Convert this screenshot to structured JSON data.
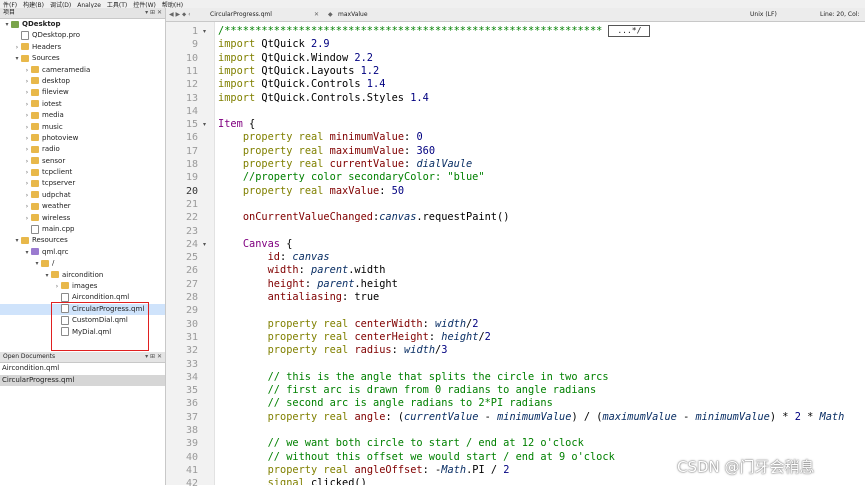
{
  "menubar": [
    "件(F)",
    "构建(B)",
    "调试(D)",
    "Analyze",
    "工具(T)",
    "控件(W)",
    "帮助(H)"
  ],
  "projects_panel": {
    "title": "项目",
    "controls": "▾  ⊞  ✕",
    "tree": [
      {
        "label": "QDesktop",
        "depth": 0,
        "arrow": "▾",
        "icon": "proj",
        "bold": true
      },
      {
        "label": "QDesktop.pro",
        "depth": 1,
        "arrow": "",
        "icon": "file"
      },
      {
        "label": "Headers",
        "depth": 1,
        "arrow": "›",
        "icon": "folder"
      },
      {
        "label": "Sources",
        "depth": 1,
        "arrow": "▾",
        "icon": "folder"
      },
      {
        "label": "cameramedia",
        "depth": 2,
        "arrow": "›",
        "icon": "folder"
      },
      {
        "label": "desktop",
        "depth": 2,
        "arrow": "›",
        "icon": "folder"
      },
      {
        "label": "fileview",
        "depth": 2,
        "arrow": "›",
        "icon": "folder"
      },
      {
        "label": "iotest",
        "depth": 2,
        "arrow": "›",
        "icon": "folder"
      },
      {
        "label": "media",
        "depth": 2,
        "arrow": "›",
        "icon": "folder"
      },
      {
        "label": "music",
        "depth": 2,
        "arrow": "›",
        "icon": "folder"
      },
      {
        "label": "photoview",
        "depth": 2,
        "arrow": "›",
        "icon": "folder"
      },
      {
        "label": "radio",
        "depth": 2,
        "arrow": "›",
        "icon": "folder"
      },
      {
        "label": "sensor",
        "depth": 2,
        "arrow": "›",
        "icon": "folder"
      },
      {
        "label": "tcpclient",
        "depth": 2,
        "arrow": "›",
        "icon": "folder"
      },
      {
        "label": "tcpserver",
        "depth": 2,
        "arrow": "›",
        "icon": "folder"
      },
      {
        "label": "udpchat",
        "depth": 2,
        "arrow": "›",
        "icon": "folder"
      },
      {
        "label": "weather",
        "depth": 2,
        "arrow": "›",
        "icon": "folder"
      },
      {
        "label": "wireless",
        "depth": 2,
        "arrow": "›",
        "icon": "folder"
      },
      {
        "label": "main.cpp",
        "depth": 2,
        "arrow": "",
        "icon": "file"
      },
      {
        "label": "Resources",
        "depth": 1,
        "arrow": "▾",
        "icon": "folder"
      },
      {
        "label": "qml.qrc",
        "depth": 2,
        "arrow": "▾",
        "icon": "res"
      },
      {
        "label": "/",
        "depth": 3,
        "arrow": "▾",
        "icon": "folder"
      },
      {
        "label": "aircondition",
        "depth": 4,
        "arrow": "▾",
        "icon": "folder"
      },
      {
        "label": "images",
        "depth": 5,
        "arrow": "›",
        "icon": "folder"
      },
      {
        "label": "Aircondition.qml",
        "depth": 5,
        "arrow": "",
        "icon": "file"
      },
      {
        "label": "CircularProgress.qml",
        "depth": 5,
        "arrow": "",
        "icon": "file",
        "selected": true
      },
      {
        "label": "CustomDial.qml",
        "depth": 5,
        "arrow": "",
        "icon": "file"
      },
      {
        "label": "MyDial.qml",
        "depth": 5,
        "arrow": "",
        "icon": "file"
      }
    ]
  },
  "open_documents": {
    "title": "Open Documents",
    "controls": "▾  ⊞  ✕",
    "items": [
      {
        "label": "Aircondition.qml",
        "selected": false
      },
      {
        "label": "CircularProgress.qml",
        "selected": true
      }
    ]
  },
  "editor": {
    "nav": "◀  ▶  ⬥  ‹",
    "file_name": "CircularProgress.qml",
    "close_glyph": "✕",
    "symbol_prefix": "◆",
    "symbol": "maxValue",
    "encoding": "Unix (LF)",
    "position": "Line: 20, Col:",
    "fold_badge": "...*/",
    "current_line": 20,
    "lines": [
      {
        "n": "1",
        "fold": "▾",
        "segs": [
          [
            "cm",
            "/*************************************************************"
          ]
        ],
        "badge": true
      },
      {
        "n": "9",
        "segs": [
          [
            "kw",
            "import"
          ],
          [
            "pl",
            " QtQuick "
          ],
          [
            "num",
            "2.9"
          ]
        ]
      },
      {
        "n": "10",
        "segs": [
          [
            "kw",
            "import"
          ],
          [
            "pl",
            " QtQuick.Window "
          ],
          [
            "num",
            "2.2"
          ]
        ]
      },
      {
        "n": "11",
        "segs": [
          [
            "kw",
            "import"
          ],
          [
            "pl",
            " QtQuick.Layouts "
          ],
          [
            "num",
            "1.2"
          ]
        ]
      },
      {
        "n": "12",
        "segs": [
          [
            "kw",
            "import"
          ],
          [
            "pl",
            " QtQuick.Controls "
          ],
          [
            "num",
            "1.4"
          ]
        ]
      },
      {
        "n": "13",
        "segs": [
          [
            "kw",
            "import"
          ],
          [
            "pl",
            " QtQuick.Controls.Styles "
          ],
          [
            "num",
            "1.4"
          ]
        ]
      },
      {
        "n": "14",
        "segs": []
      },
      {
        "n": "15",
        "fold": "▾",
        "segs": [
          [
            "ty",
            "Item"
          ],
          [
            "pl",
            " {"
          ]
        ]
      },
      {
        "n": "16",
        "segs": [
          [
            "pl",
            "    "
          ],
          [
            "kw",
            "property"
          ],
          [
            "pl",
            " "
          ],
          [
            "kw",
            "real"
          ],
          [
            "pl",
            " "
          ],
          [
            "prop",
            "minimumValue"
          ],
          [
            "pl",
            ": "
          ],
          [
            "num",
            "0"
          ]
        ]
      },
      {
        "n": "17",
        "segs": [
          [
            "pl",
            "    "
          ],
          [
            "kw",
            "property"
          ],
          [
            "pl",
            " "
          ],
          [
            "kw",
            "real"
          ],
          [
            "pl",
            " "
          ],
          [
            "prop",
            "maximumValue"
          ],
          [
            "pl",
            ": "
          ],
          [
            "num",
            "360"
          ]
        ]
      },
      {
        "n": "18",
        "segs": [
          [
            "pl",
            "    "
          ],
          [
            "kw",
            "property"
          ],
          [
            "pl",
            " "
          ],
          [
            "kw",
            "real"
          ],
          [
            "pl",
            " "
          ],
          [
            "prop",
            "currentValue"
          ],
          [
            "pl",
            ": "
          ],
          [
            "it",
            "dialVaule"
          ]
        ]
      },
      {
        "n": "19",
        "segs": [
          [
            "pl",
            "    "
          ],
          [
            "cm",
            "//property color secondaryColor: \"blue\""
          ]
        ]
      },
      {
        "n": "20",
        "segs": [
          [
            "pl",
            "    "
          ],
          [
            "kw",
            "property"
          ],
          [
            "pl",
            " "
          ],
          [
            "kw",
            "real"
          ],
          [
            "pl",
            " "
          ],
          [
            "prop",
            "maxValue"
          ],
          [
            "pl",
            ": "
          ],
          [
            "num",
            "50"
          ]
        ]
      },
      {
        "n": "21",
        "segs": []
      },
      {
        "n": "22",
        "segs": [
          [
            "pl",
            "    "
          ],
          [
            "prop",
            "onCurrentValueChanged"
          ],
          [
            "pl",
            ":"
          ],
          [
            "it",
            "canvas"
          ],
          [
            "pl",
            ".requestPaint()"
          ]
        ]
      },
      {
        "n": "23",
        "segs": []
      },
      {
        "n": "24",
        "fold": "▾",
        "segs": [
          [
            "pl",
            "    "
          ],
          [
            "ty",
            "Canvas"
          ],
          [
            "pl",
            " {"
          ]
        ]
      },
      {
        "n": "25",
        "segs": [
          [
            "pl",
            "        "
          ],
          [
            "prop",
            "id"
          ],
          [
            "pl",
            ": "
          ],
          [
            "it",
            "canvas"
          ]
        ]
      },
      {
        "n": "26",
        "segs": [
          [
            "pl",
            "        "
          ],
          [
            "prop",
            "width"
          ],
          [
            "pl",
            ": "
          ],
          [
            "it",
            "parent"
          ],
          [
            "pl",
            ".width"
          ]
        ]
      },
      {
        "n": "27",
        "segs": [
          [
            "pl",
            "        "
          ],
          [
            "prop",
            "height"
          ],
          [
            "pl",
            ": "
          ],
          [
            "it",
            "parent"
          ],
          [
            "pl",
            ".height"
          ]
        ]
      },
      {
        "n": "28",
        "segs": [
          [
            "pl",
            "        "
          ],
          [
            "prop",
            "antialiasing"
          ],
          [
            "pl",
            ": "
          ],
          [
            "pl",
            "true"
          ]
        ]
      },
      {
        "n": "29",
        "segs": []
      },
      {
        "n": "30",
        "segs": [
          [
            "pl",
            "        "
          ],
          [
            "kw",
            "property"
          ],
          [
            "pl",
            " "
          ],
          [
            "kw",
            "real"
          ],
          [
            "pl",
            " "
          ],
          [
            "prop",
            "centerWidth"
          ],
          [
            "pl",
            ": "
          ],
          [
            "it",
            "width"
          ],
          [
            "pl",
            "/"
          ],
          [
            "num",
            "2"
          ]
        ]
      },
      {
        "n": "31",
        "segs": [
          [
            "pl",
            "        "
          ],
          [
            "kw",
            "property"
          ],
          [
            "pl",
            " "
          ],
          [
            "kw",
            "real"
          ],
          [
            "pl",
            " "
          ],
          [
            "prop",
            "centerHeight"
          ],
          [
            "pl",
            ": "
          ],
          [
            "it",
            "height"
          ],
          [
            "pl",
            "/"
          ],
          [
            "num",
            "2"
          ]
        ]
      },
      {
        "n": "32",
        "segs": [
          [
            "pl",
            "        "
          ],
          [
            "kw",
            "property"
          ],
          [
            "pl",
            " "
          ],
          [
            "kw",
            "real"
          ],
          [
            "pl",
            " "
          ],
          [
            "prop",
            "radius"
          ],
          [
            "pl",
            ": "
          ],
          [
            "it",
            "width"
          ],
          [
            "pl",
            "/"
          ],
          [
            "num",
            "3"
          ]
        ]
      },
      {
        "n": "33",
        "segs": []
      },
      {
        "n": "34",
        "segs": [
          [
            "pl",
            "        "
          ],
          [
            "cm",
            "// this is the angle that splits the circle in two arcs"
          ]
        ]
      },
      {
        "n": "35",
        "segs": [
          [
            "pl",
            "        "
          ],
          [
            "cm",
            "// first arc is drawn from 0 radians to angle radians"
          ]
        ]
      },
      {
        "n": "36",
        "segs": [
          [
            "pl",
            "        "
          ],
          [
            "cm",
            "// second arc is angle radians to 2*PI radians"
          ]
        ]
      },
      {
        "n": "37",
        "segs": [
          [
            "pl",
            "        "
          ],
          [
            "kw",
            "property"
          ],
          [
            "pl",
            " "
          ],
          [
            "kw",
            "real"
          ],
          [
            "pl",
            " "
          ],
          [
            "prop",
            "angle"
          ],
          [
            "pl",
            ": ("
          ],
          [
            "it",
            "currentValue"
          ],
          [
            "pl",
            " - "
          ],
          [
            "it",
            "minimumValue"
          ],
          [
            "pl",
            ") / ("
          ],
          [
            "it",
            "maximumValue"
          ],
          [
            "pl",
            " - "
          ],
          [
            "it",
            "minimumValue"
          ],
          [
            "pl",
            ") * "
          ],
          [
            "num",
            "2"
          ],
          [
            "pl",
            " * "
          ],
          [
            "it",
            "Math"
          ]
        ]
      },
      {
        "n": "38",
        "segs": []
      },
      {
        "n": "39",
        "segs": [
          [
            "pl",
            "        "
          ],
          [
            "cm",
            "// we want both circle to start / end at 12 o'clock"
          ]
        ]
      },
      {
        "n": "40",
        "segs": [
          [
            "pl",
            "        "
          ],
          [
            "cm",
            "// without this offset we would start / end at 9 o'clock"
          ]
        ]
      },
      {
        "n": "41",
        "segs": [
          [
            "pl",
            "        "
          ],
          [
            "kw",
            "property"
          ],
          [
            "pl",
            " "
          ],
          [
            "kw",
            "real"
          ],
          [
            "pl",
            " "
          ],
          [
            "prop",
            "angleOffset"
          ],
          [
            "pl",
            ": -"
          ],
          [
            "it",
            "Math"
          ],
          [
            "pl",
            ".PI / "
          ],
          [
            "num",
            "2"
          ]
        ]
      },
      {
        "n": "42",
        "segs": [
          [
            "pl",
            "        "
          ],
          [
            "kw",
            "signal"
          ],
          [
            "pl",
            " clicked()"
          ]
        ]
      }
    ]
  },
  "watermark": "CSDN @门牙会稍息"
}
